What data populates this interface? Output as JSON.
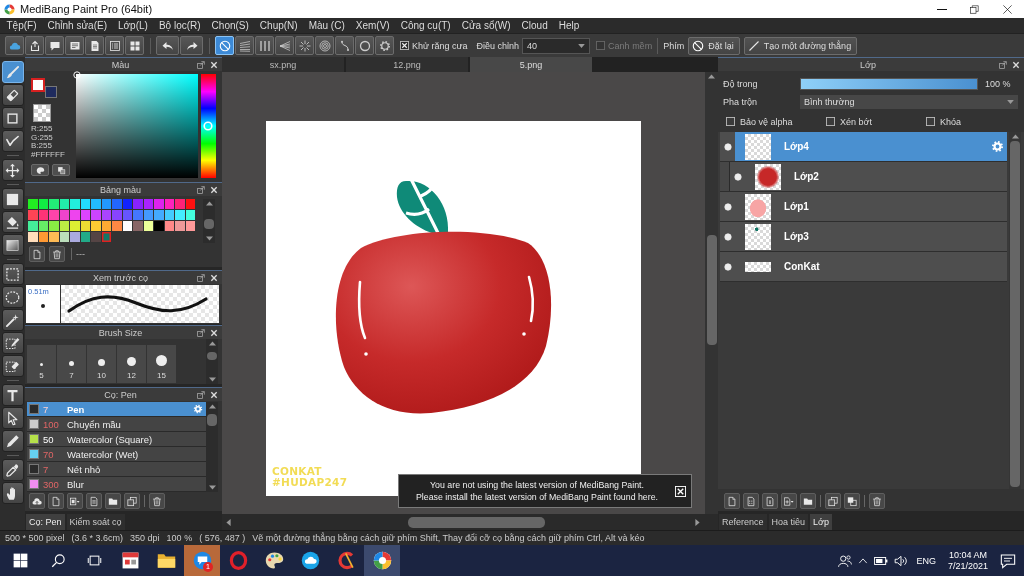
{
  "window": {
    "title": "MediBang Paint Pro (64bit)"
  },
  "menu": [
    "Tệp(F)",
    "Chỉnh sửa(E)",
    "Lớp(L)",
    "Bộ lọc(R)",
    "Chọn(S)",
    "Chụp(N)",
    "Màu (C)",
    "Xem(V)",
    "Công cụ(T)",
    "Cửa sổ(W)",
    "Cloud",
    "Help"
  ],
  "toolbar": {
    "rulers": [
      {
        "selected": true
      },
      {
        "selected": false
      },
      {
        "selected": false
      },
      {
        "selected": false
      },
      {
        "selected": false
      },
      {
        "selected": false
      },
      {
        "selected": false
      },
      {
        "selected": false
      },
      {
        "selected": false
      }
    ],
    "antialias": {
      "label": "Khử răng cưa",
      "checked": true
    },
    "correction": {
      "label": "Điều chỉnh",
      "value": "40"
    },
    "soft_edge": {
      "label": "Canh mềm",
      "checked": false,
      "disabled": true
    },
    "keys_label": "Phím",
    "reset_button": "Đặt lại",
    "line_button": "Tạo một đường thẳng"
  },
  "tools": [
    [
      {
        "selected": true
      },
      {
        "selected": false
      },
      {
        "selected": false
      },
      {
        "selected": false
      }
    ],
    [
      {
        "selected": false
      }
    ],
    [
      {
        "selected": false
      },
      {
        "selected": false
      },
      {
        "selected": false
      }
    ],
    [
      {
        "selected": false
      },
      {
        "selected": false
      },
      {
        "selected": false
      },
      {
        "selected": false
      },
      {
        "selected": false
      }
    ],
    [
      {
        "selected": false
      },
      {
        "selected": false
      },
      {
        "selected": false
      }
    ],
    [
      {
        "selected": false
      },
      {
        "selected": false
      }
    ]
  ],
  "color_panel": {
    "title": "Màu",
    "swatches": [
      {
        "color": "#ffffff",
        "selected": true
      },
      {
        "color": "#1f2b5e",
        "selected": false
      }
    ],
    "r": "R:255",
    "g": "G:255",
    "b": "B:255",
    "hex": "#FFFFFF",
    "hue": {
      "level": 0.5
    }
  },
  "palette": {
    "title": "Bảng màu",
    "swatches": [
      {
        "color": "#22ee22",
        "selected": false
      },
      {
        "color": "#11ee44",
        "selected": false
      },
      {
        "color": "#22ee77",
        "selected": false
      },
      {
        "color": "#22eeaa",
        "selected": false
      },
      {
        "color": "#22eedd",
        "selected": false
      },
      {
        "color": "#22ddff",
        "selected": false
      },
      {
        "color": "#22bbff",
        "selected": false
      },
      {
        "color": "#2299ff",
        "selected": false
      },
      {
        "color": "#2266ff",
        "selected": false
      },
      {
        "color": "#1122ff",
        "selected": false
      },
      {
        "color": "#8822ff",
        "selected": false
      },
      {
        "color": "#aa22ff",
        "selected": false
      },
      {
        "color": "#dd22ee",
        "selected": false
      },
      {
        "color": "#ff22bb",
        "selected": false
      },
      {
        "color": "#ff2277",
        "selected": false
      },
      {
        "color": "#ff1111",
        "selected": false
      },
      {
        "color": "#ff4455",
        "selected": false
      },
      {
        "color": "#ff3377",
        "selected": false
      },
      {
        "color": "#ff44aa",
        "selected": false
      },
      {
        "color": "#ee44cc",
        "selected": false
      },
      {
        "color": "#ee44ee",
        "selected": false
      },
      {
        "color": "#dd44ff",
        "selected": false
      },
      {
        "color": "#cc44ff",
        "selected": false
      },
      {
        "color": "#aa44ff",
        "selected": false
      },
      {
        "color": "#8844ff",
        "selected": false
      },
      {
        "color": "#6655ff",
        "selected": false
      },
      {
        "color": "#4477ff",
        "selected": false
      },
      {
        "color": "#4499ff",
        "selected": false
      },
      {
        "color": "#44aaff",
        "selected": false
      },
      {
        "color": "#44ccff",
        "selected": false
      },
      {
        "color": "#44eeff",
        "selected": false
      },
      {
        "color": "#44ffdd",
        "selected": false
      },
      {
        "color": "#44ee99",
        "selected": false
      },
      {
        "color": "#66ee66",
        "selected": false
      },
      {
        "color": "#88ee44",
        "selected": false
      },
      {
        "color": "#bbee44",
        "selected": false
      },
      {
        "color": "#ddee33",
        "selected": false
      },
      {
        "color": "#eedd33",
        "selected": false
      },
      {
        "color": "#ffcc33",
        "selected": false
      },
      {
        "color": "#ffaa33",
        "selected": false
      },
      {
        "color": "#ff8844",
        "selected": false
      },
      {
        "color": "#ffffff",
        "selected": false
      },
      {
        "color": "#886666",
        "selected": false
      },
      {
        "color": "#eeff99",
        "selected": false
      },
      {
        "color": "#000000",
        "selected": false
      },
      {
        "color": "#ff8888",
        "selected": false
      },
      {
        "color": "#ee9999",
        "selected": false
      },
      {
        "color": "#ff9999",
        "selected": false
      },
      {
        "color": "#ffddbb",
        "selected": false
      },
      {
        "color": "#ff9933",
        "selected": false
      },
      {
        "color": "#ffbb55",
        "selected": false
      },
      {
        "color": "#bbddbb",
        "selected": false
      },
      {
        "color": "#aaaadd",
        "selected": false
      },
      {
        "color": "#22aa88",
        "selected": false
      },
      {
        "color": "#554444",
        "selected": false
      },
      {
        "color": "#117766",
        "selected": true
      }
    ],
    "footer_text": "---"
  },
  "brush_preview": {
    "title": "Xem trước cọ",
    "size": "0.51m"
  },
  "brush_size": {
    "title": "Brush Size",
    "sizes": [
      "5",
      "7",
      "10",
      "12",
      "15"
    ]
  },
  "brushes": {
    "title": "Cọ: Pen",
    "items": [
      {
        "color": "#2b2b2b",
        "size": "7",
        "size_marked": true,
        "name": "Pen",
        "selected": true
      },
      {
        "color": "#cccccc",
        "size": "100",
        "size_marked": true,
        "name": "Chuyển mầu",
        "selected": false
      },
      {
        "color": "#b5e04a",
        "size": "50",
        "size_marked": false,
        "name": "Watercolor (Square)",
        "selected": false
      },
      {
        "color": "#66d0f0",
        "size": "70",
        "size_marked": true,
        "name": "Watercolor (Wet)",
        "selected": false
      },
      {
        "color": "#2b2b2b",
        "size": "7",
        "size_marked": true,
        "name": "Nét nhỏ",
        "selected": false
      },
      {
        "color": "#f08ef0",
        "size": "300",
        "size_marked": true,
        "name": "Blur",
        "selected": false
      }
    ]
  },
  "left_tabs": [
    {
      "label": "Cọ: Pen",
      "selected": true
    },
    {
      "label": "Kiểm soát cọ",
      "selected": false
    }
  ],
  "document_tabs": [
    {
      "label": "sx.png",
      "selected": false
    },
    {
      "label": "12.png",
      "selected": false
    },
    {
      "label": "5.png",
      "selected": true
    }
  ],
  "canvas": {
    "signature": [
      "CONKAT",
      "#HUDAP247"
    ]
  },
  "notification": {
    "lines": [
      "You are not using the latest version of MediBang Paint.",
      "Please install the latest version of MediBang Paint found here."
    ]
  },
  "layer_panel": {
    "title": "Lớp",
    "opacity": {
      "label": "Độ trong",
      "level": 1,
      "reading": "100 %"
    },
    "blend": {
      "label": "Pha trộn",
      "value": "Bình thường"
    },
    "options": [
      {
        "label": "Bảo vệ alpha",
        "checked": false
      },
      {
        "label": "Xén bớt",
        "checked": false
      },
      {
        "label": "Khóa",
        "checked": false
      }
    ],
    "layers": [
      {
        "name": "Lớp4",
        "selected": true,
        "clipped": false,
        "visible": true
      },
      {
        "name": "Lớp2",
        "selected": false,
        "clipped": true,
        "visible": true
      },
      {
        "name": "Lớp1",
        "selected": false,
        "clipped": false,
        "visible": true
      },
      {
        "name": "Lớp3",
        "selected": false,
        "clipped": false,
        "visible": true
      },
      {
        "name": "ConKat",
        "selected": false,
        "clipped": false,
        "visible": true
      }
    ]
  },
  "right_tabs": [
    {
      "label": "Reference",
      "selected": false
    },
    {
      "label": "Hoa tiêu",
      "selected": false
    },
    {
      "label": "Lớp",
      "selected": true
    }
  ],
  "status_bar": [
    "500 * 500 pixel",
    "(3.6 * 3.6cm)",
    "350 dpi",
    "100 %",
    "( 576, 487 )",
    "Vẽ một đường thẳng bằng cách giữ phím Shift, Thay đổi cỡ cọ bằng cách giữ phím Ctrl, Alt và kéo"
  ],
  "taskbar": {
    "apps": [
      {
        "active": false,
        "flashing": false
      },
      {
        "active": false,
        "flashing": false
      },
      {
        "active": false,
        "flashing": true,
        "badge": "1"
      },
      {
        "active": false,
        "flashing": false
      },
      {
        "active": false,
        "flashing": false
      },
      {
        "active": false,
        "flashing": false
      },
      {
        "active": false,
        "flashing": false
      },
      {
        "active": true,
        "flashing": false
      }
    ],
    "language": "ENG",
    "time": "10:04 AM",
    "date": "7/21/2021"
  }
}
